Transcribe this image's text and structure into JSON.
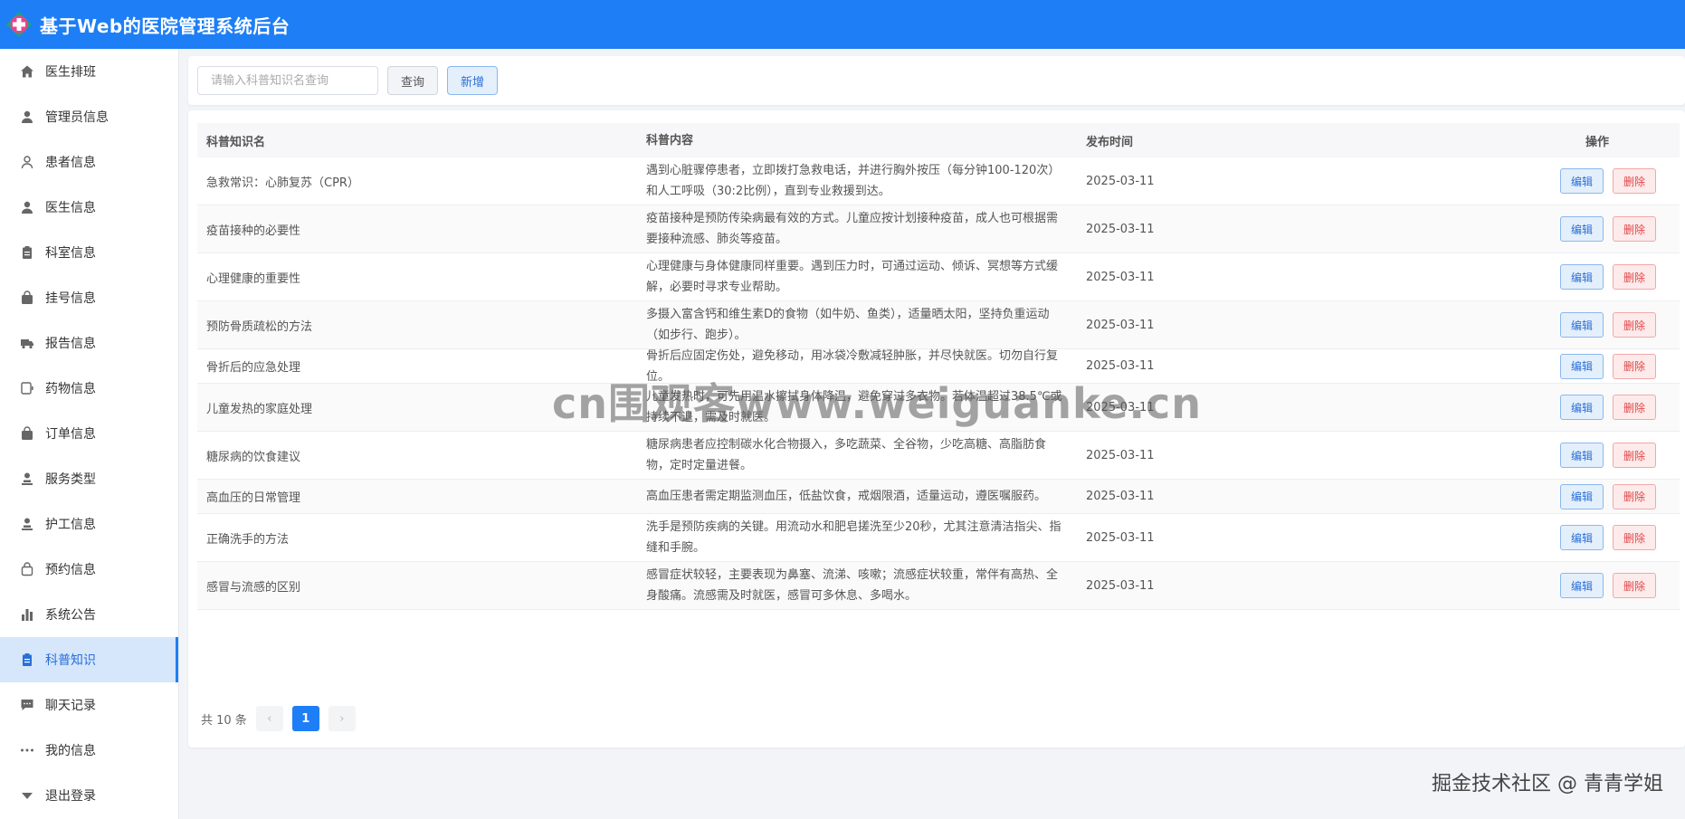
{
  "header": {
    "title": "基于Web的医院管理系统后台"
  },
  "sidebar": {
    "items": [
      {
        "label": "医生排班",
        "icon": "home-icon",
        "active": false
      },
      {
        "label": "管理员信息",
        "icon": "user-icon",
        "active": false
      },
      {
        "label": "患者信息",
        "icon": "user-outline-icon",
        "active": false
      },
      {
        "label": "医生信息",
        "icon": "user-icon",
        "active": false
      },
      {
        "label": "科室信息",
        "icon": "clipboard-icon",
        "active": false
      },
      {
        "label": "挂号信息",
        "icon": "bag-icon",
        "active": false
      },
      {
        "label": "报告信息",
        "icon": "truck-icon",
        "active": false
      },
      {
        "label": "药物信息",
        "icon": "tablet-icon",
        "active": false
      },
      {
        "label": "订单信息",
        "icon": "bag-icon",
        "active": false
      },
      {
        "label": "服务类型",
        "icon": "user-stand-icon",
        "active": false
      },
      {
        "label": "护工信息",
        "icon": "user-stand-icon",
        "active": false
      },
      {
        "label": "预约信息",
        "icon": "bag-outline-icon",
        "active": false
      },
      {
        "label": "系统公告",
        "icon": "bar-chart-icon",
        "active": false
      },
      {
        "label": "科普知识",
        "icon": "clipboard-icon",
        "active": true
      },
      {
        "label": "聊天记录",
        "icon": "chat-icon",
        "active": false
      },
      {
        "label": "我的信息",
        "icon": "more-dots-icon",
        "active": false
      },
      {
        "label": "退出登录",
        "icon": "caret-down-icon",
        "active": false
      }
    ]
  },
  "toolbar": {
    "search_placeholder": "请输入科普知识名查询",
    "search_value": "",
    "query_label": "查询",
    "add_label": "新增"
  },
  "table": {
    "headers": [
      "科普知识名",
      "科普内容",
      "发布时间",
      "操作"
    ],
    "edit_label": "编辑",
    "delete_label": "删除",
    "rows": [
      {
        "name": "急救常识：心肺复苏（CPR）",
        "content": "遇到心脏骤停患者，立即拨打急救电话，并进行胸外按压（每分钟100-120次）和人工呼吸（30:2比例），直到专业救援到达。",
        "date": "2025-03-11"
      },
      {
        "name": "疫苗接种的必要性",
        "content": "疫苗接种是预防传染病最有效的方式。儿童应按计划接种疫苗，成人也可根据需要接种流感、肺炎等疫苗。",
        "date": "2025-03-11"
      },
      {
        "name": "心理健康的重要性",
        "content": "心理健康与身体健康同样重要。遇到压力时，可通过运动、倾诉、冥想等方式缓解，必要时寻求专业帮助。",
        "date": "2025-03-11"
      },
      {
        "name": "预防骨质疏松的方法",
        "content": "多摄入富含钙和维生素D的食物（如牛奶、鱼类），适量晒太阳，坚持负重运动（如步行、跑步）。",
        "date": "2025-03-11"
      },
      {
        "name": "骨折后的应急处理",
        "content": "骨折后应固定伤处，避免移动，用冰袋冷敷减轻肿胀，并尽快就医。切勿自行复位。",
        "date": "2025-03-11"
      },
      {
        "name": "儿童发热的家庭处理",
        "content": "儿童发热时，可先用温水擦拭身体降温，避免穿过多衣物。若体温超过38.5℃或持续不退，需及时就医。",
        "date": "2025-03-11"
      },
      {
        "name": "糖尿病的饮食建议",
        "content": "糖尿病患者应控制碳水化合物摄入，多吃蔬菜、全谷物，少吃高糖、高脂肪食物，定时定量进餐。",
        "date": "2025-03-11"
      },
      {
        "name": "高血压的日常管理",
        "content": "高血压患者需定期监测血压，低盐饮食，戒烟限酒，适量运动，遵医嘱服药。",
        "date": "2025-03-11"
      },
      {
        "name": "正确洗手的方法",
        "content": "洗手是预防疾病的关键。用流动水和肥皂搓洗至少20秒，尤其注意清洁指尖、指缝和手腕。",
        "date": "2025-03-11"
      },
      {
        "name": "感冒与流感的区别",
        "content": "感冒症状较轻，主要表现为鼻塞、流涕、咳嗽；流感症状较重，常伴有高热、全身酸痛。流感需及时就医，感冒可多休息、多喝水。",
        "date": "2025-03-11"
      }
    ]
  },
  "pagination": {
    "total_text": "共 10 条",
    "current_page": "1",
    "prev": "‹",
    "next": "›"
  },
  "watermarks": {
    "center": "cn围观客www.weiguanke.cn",
    "corner": "掘金技术社区 @ 青青学姐"
  },
  "colors": {
    "primary": "#1e7ef5",
    "danger": "#e04848",
    "active_bg": "#d6e6fb"
  }
}
